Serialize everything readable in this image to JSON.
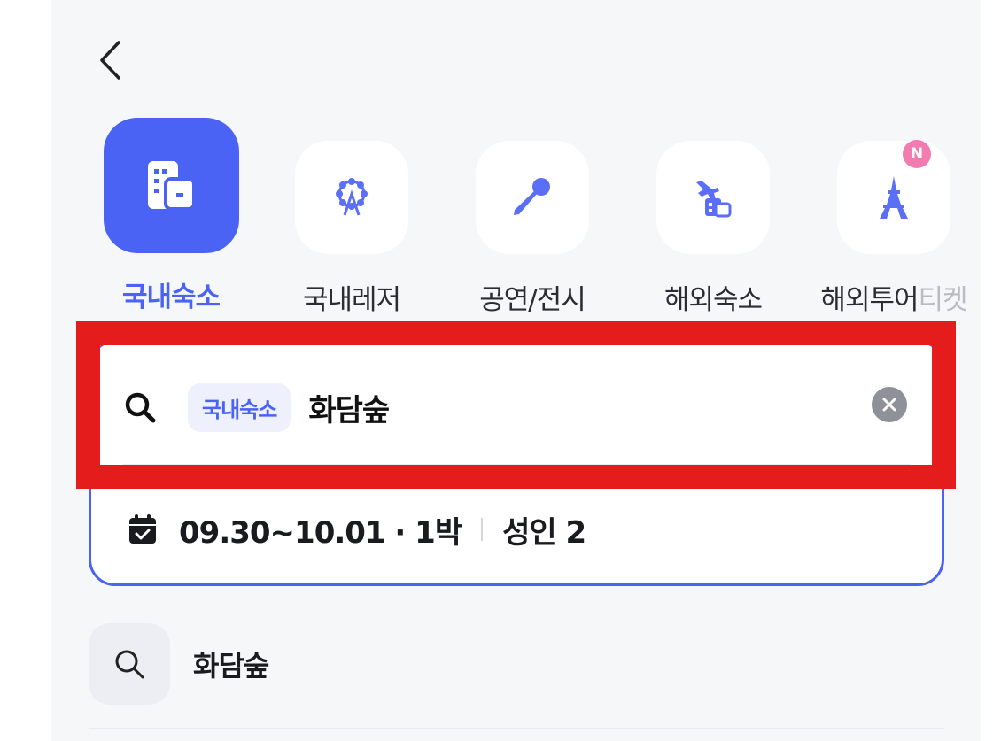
{
  "categories": [
    {
      "label": "국내숙소",
      "icon": "building-icon",
      "active": true
    },
    {
      "label": "국내레저",
      "icon": "ferris-wheel-icon",
      "active": false
    },
    {
      "label": "공연/전시",
      "icon": "microphone-icon",
      "active": false
    },
    {
      "label": "해외숙소",
      "icon": "airplane-hotel-icon",
      "active": false
    },
    {
      "label_main": "해외투어",
      "label_faded": "티켓",
      "icon": "eiffel-tower-icon",
      "badge": "N",
      "active": false
    }
  ],
  "search": {
    "chip": "국내숙소",
    "value": "화담숲"
  },
  "booking": {
    "dates": "09.30~10.01 · 1박",
    "guests": "성인 2"
  },
  "recent": [
    {
      "label": "화담숲",
      "icon": "search-icon"
    }
  ],
  "colors": {
    "accent": "#4a63f5",
    "highlight": "#e41c1c",
    "badge": "#f27bb0"
  }
}
